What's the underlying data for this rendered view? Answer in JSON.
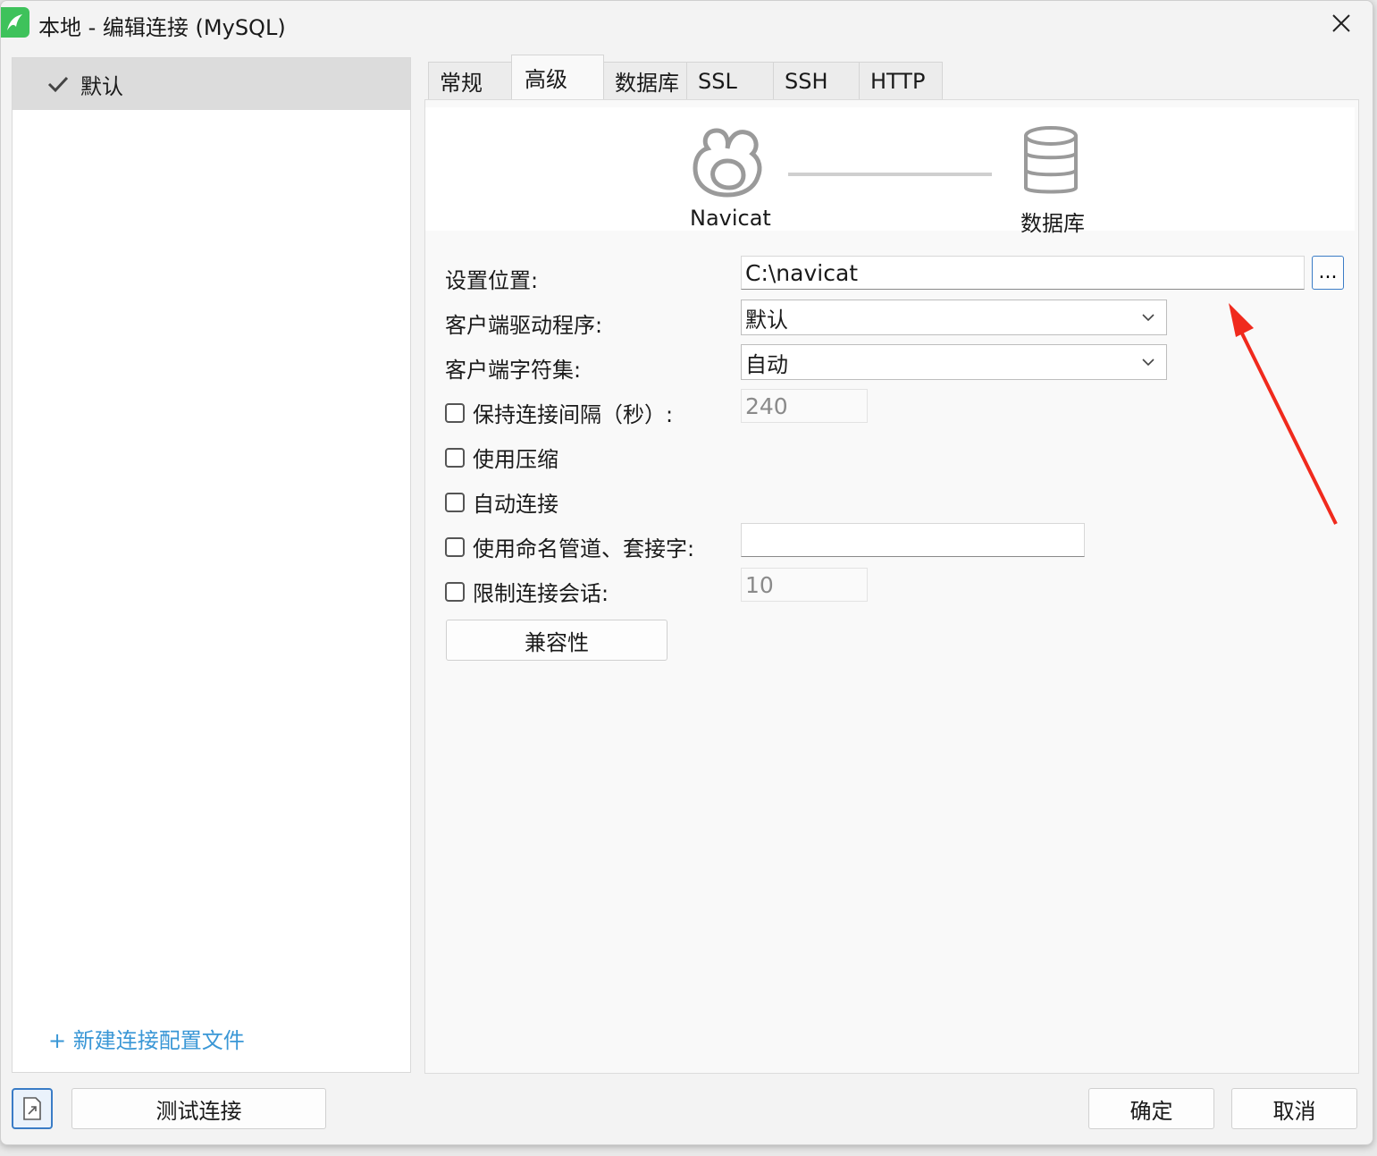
{
  "window": {
    "title": "本地 - 编辑连接 (MySQL)"
  },
  "sidebar": {
    "profiles": [
      {
        "label": "默认",
        "selected": true
      }
    ],
    "new_profile_link": "+ 新建连接配置文件"
  },
  "tabs": [
    {
      "label": "常规",
      "active": false
    },
    {
      "label": "高级",
      "active": true
    },
    {
      "label": "数据库",
      "active": false
    },
    {
      "label": "SSL",
      "active": false
    },
    {
      "label": "SSH",
      "active": false
    },
    {
      "label": "HTTP",
      "active": false
    }
  ],
  "diagram": {
    "left_label": "Navicat",
    "right_label": "数据库"
  },
  "form": {
    "settings_location": {
      "label": "设置位置:",
      "value": "C:\\navicat",
      "browse_label": "..."
    },
    "client_driver": {
      "label": "客户端驱动程序:",
      "value": "默认"
    },
    "client_charset": {
      "label": "客户端字符集:",
      "value": "自动"
    },
    "keepalive": {
      "label": "保持连接间隔（秒）:",
      "checked": false,
      "value": "240"
    },
    "use_compression": {
      "label": "使用压缩",
      "checked": false
    },
    "auto_connect": {
      "label": "自动连接",
      "checked": false
    },
    "named_pipe": {
      "label": "使用命名管道、套接字:",
      "checked": false,
      "value": ""
    },
    "limit_sessions": {
      "label": "限制连接会话:",
      "checked": false,
      "value": "10"
    },
    "compatibility_button": "兼容性"
  },
  "footer": {
    "test_connection": "测试连接",
    "ok": "确定",
    "cancel": "取消"
  },
  "colors": {
    "accent_blue": "#3a97d6",
    "annotation_red": "#f02a1d",
    "app_green": "#3ec25b"
  }
}
